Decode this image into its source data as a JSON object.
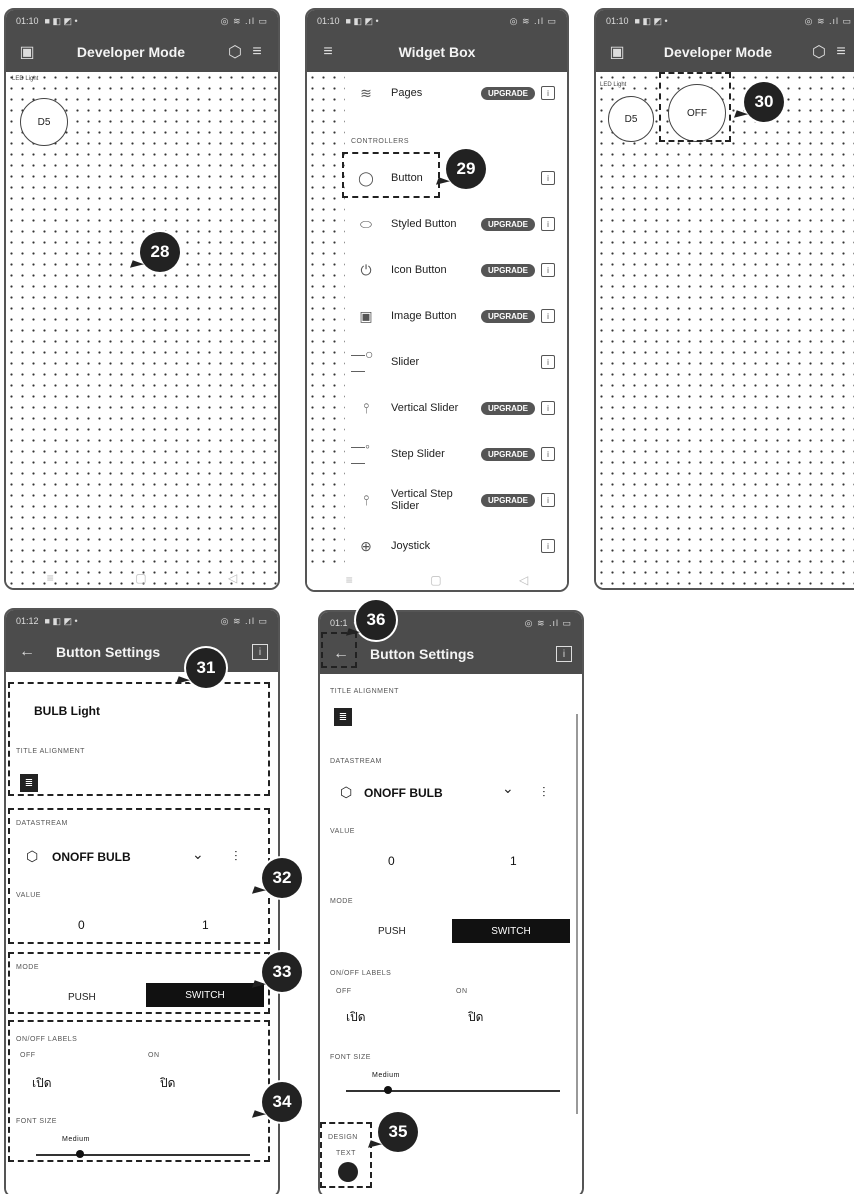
{
  "phone1": {
    "status": {
      "time": "01:10",
      "icons": "■ ◧ ◩ •",
      "right": "◎ ≋ .ıl ▭"
    },
    "title": "Developer Mode",
    "led_label": "LED Light",
    "button_label": "D5",
    "callout": "28"
  },
  "phone2": {
    "status": {
      "time": "01:10",
      "icons": "■ ◧ ◩ •",
      "right": "◎ ≋ .ıl ▭"
    },
    "title": "Widget Box",
    "pages_label": "Pages",
    "section_controllers": "CONTROLLERS",
    "upgrade_label": "UPGRADE",
    "info_label": "i",
    "items": [
      {
        "label": "Button",
        "upgrade": false,
        "icon": "circle-icon"
      },
      {
        "label": "Styled Button",
        "upgrade": true,
        "icon": "styled-button-icon"
      },
      {
        "label": "Icon Button",
        "upgrade": true,
        "icon": "power-icon"
      },
      {
        "label": "Image Button",
        "upgrade": true,
        "icon": "image-icon"
      },
      {
        "label": "Slider",
        "upgrade": false,
        "icon": "slider-icon"
      },
      {
        "label": "Vertical Slider",
        "upgrade": true,
        "icon": "vertical-slider-icon"
      },
      {
        "label": "Step Slider",
        "upgrade": true,
        "icon": "step-slider-icon"
      },
      {
        "label": "Vertical Step Slider",
        "upgrade": true,
        "icon": "vertical-step-slider-icon"
      },
      {
        "label": "Joystick",
        "upgrade": false,
        "icon": "joystick-icon"
      }
    ],
    "callout": "29"
  },
  "phone3": {
    "status": {
      "time": "01:10",
      "icons": "■ ◧ ◩ •",
      "right": "◎ ≋ .ıl ▭"
    },
    "title": "Developer Mode",
    "led_label": "LED Light",
    "button_d5": "D5",
    "button_off": "OFF",
    "callout": "30"
  },
  "phone4": {
    "status": {
      "time": "01:12",
      "icons": "■ ◧ ◩ •",
      "right": "◎ ≋ .ıl ▭"
    },
    "title": "Button Settings",
    "widget_title": "BULB Light",
    "title_alignment_label": "TITLE ALIGNMENT",
    "datastream_label": "DATASTREAM",
    "datastream_value": "ONOFF BULB",
    "value_label": "VALUE",
    "value_min": "0",
    "value_max": "1",
    "mode_label": "MODE",
    "mode_push": "PUSH",
    "mode_switch": "SWITCH",
    "onoff_label": "ON/OFF LABELS",
    "off_label": "OFF",
    "on_label": "ON",
    "off_value": "เปิด",
    "on_value": "ปิด",
    "font_size_label": "FONT SIZE",
    "font_size_value": "Medium",
    "callouts": [
      "31",
      "32",
      "33",
      "34"
    ]
  },
  "phone5": {
    "status": {
      "time": "01:1",
      "icons": "•",
      "right": "◎ ≋ .ıl ▭"
    },
    "title": "Button Settings",
    "title_alignment_label": "TITLE ALIGNMENT",
    "datastream_label": "DATASTREAM",
    "datastream_value": "ONOFF BULB",
    "value_label": "VALUE",
    "value_min": "0",
    "value_max": "1",
    "mode_label": "MODE",
    "mode_push": "PUSH",
    "mode_switch": "SWITCH",
    "onoff_label": "ON/OFF LABELS",
    "off_label": "OFF",
    "on_label": "ON",
    "off_value": "เปิด",
    "on_value": "ปิด",
    "font_size_label": "FONT SIZE",
    "font_size_value": "Medium",
    "design_label": "DESIGN",
    "design_text": "TEXT",
    "callouts": [
      "35",
      "36"
    ]
  }
}
